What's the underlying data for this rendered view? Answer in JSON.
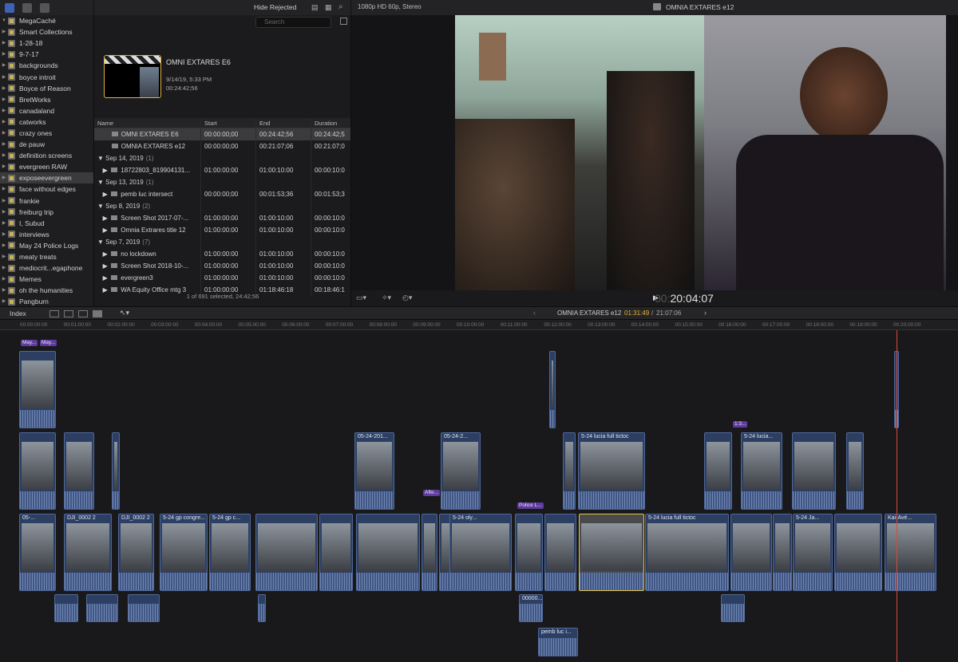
{
  "browser_toolbar": {
    "filter_label": "Hide Rejected"
  },
  "viewer_toolbar": {
    "format": "1080p HD 60p, Stereo",
    "project_title": "OMNIA EXTARES e12"
  },
  "library": {
    "name": "MegaCaché",
    "items": [
      "Smart Collections",
      "1-28-18",
      "9-7-17",
      "backgrounds",
      "boyce introit",
      "Boyce of Reason",
      "BretWorks",
      "canadaland",
      "catworks",
      "crazy ones",
      "de pauw",
      "definition screens",
      "evergreen RAW",
      "exposeevergreen",
      "face without edges",
      "frankie",
      "freiburg trip",
      "I, Subud",
      "interviews",
      "May 24 Police Logs",
      "meaty treats",
      "mediocrit...egaphone",
      "Memes",
      "oh the humanities",
      "Pangburn"
    ]
  },
  "browser": {
    "search_placeholder": "Search",
    "clip_title": "OMNI EXTARES E6",
    "clip_date": "9/14/19, 5:33 PM",
    "clip_duration": "00:24:42;56",
    "columns": [
      "Name",
      "Start",
      "End",
      "Duration"
    ],
    "rows": [
      {
        "type": "clip",
        "name": "OMNI EXTARES E6",
        "start": "00:00:00;00",
        "end": "00:24:42;56",
        "duration": "00:24:42;5"
      },
      {
        "type": "clip",
        "name": "OMNIA EXTARES e12",
        "start": "00:00:00;00",
        "end": "00:21:07;06",
        "duration": "00:21:07;0"
      },
      {
        "type": "group",
        "name": "Sep 14, 2019",
        "count": "(1)"
      },
      {
        "type": "clip",
        "name": "18722803_819904131...",
        "start": "01:00:00:00",
        "end": "01:00:10:00",
        "duration": "00:00:10:0"
      },
      {
        "type": "group",
        "name": "Sep 13, 2019",
        "count": "(1)"
      },
      {
        "type": "clip",
        "name": "pemb luc intersect",
        "start": "00:00:00;00",
        "end": "00:01:53;36",
        "duration": "00:01:53;3"
      },
      {
        "type": "group",
        "name": "Sep 8, 2019",
        "count": "(2)"
      },
      {
        "type": "clip",
        "name": "Screen Shot 2017-07-...",
        "start": "01:00:00:00",
        "end": "01:00:10:00",
        "duration": "00:00:10:0"
      },
      {
        "type": "clip",
        "name": "Omnia Extrares title 12",
        "start": "01:00:00:00",
        "end": "01:00:10:00",
        "duration": "00:00:10:0"
      },
      {
        "type": "group",
        "name": "Sep 7, 2019",
        "count": "(7)"
      },
      {
        "type": "clip",
        "name": "no lockdown",
        "start": "01:00:00:00",
        "end": "01:00:10:00",
        "duration": "00:00:10:0"
      },
      {
        "type": "clip",
        "name": "Screen Shot 2018-10-...",
        "start": "01:00:00:00",
        "end": "01:00:10:00",
        "duration": "00:00:10:0"
      },
      {
        "type": "clip",
        "name": "evergreen3",
        "start": "01:00:00:00",
        "end": "01:00:10:00",
        "duration": "00:00:10:0"
      },
      {
        "type": "clip",
        "name": "WA Equity Office mtg 3",
        "start": "01:00:00:00",
        "end": "01:18:46:18",
        "duration": "00:18:46:1"
      }
    ],
    "status": "1 of 691 selected, 24:42;56"
  },
  "viewer": {
    "timecode_dim": "00:",
    "timecode": "20:04:07"
  },
  "timeline": {
    "index_label": "Index",
    "project": "OMNIA EXTARES e12",
    "position": "01:31:49",
    "total": "21:07:06",
    "ruler": [
      "00:00:00:00",
      "00:01:00:00",
      "00:02:00:00",
      "00:03:00:00",
      "00:04:00:00",
      "00:05:00:00",
      "00:06:00:00",
      "00:07:00:00",
      "00:08:00:00",
      "00:09:00:00",
      "00:10:00:00",
      "00:11:00:00",
      "00:12:00:00",
      "00:13:00:00",
      "00:14:00:00",
      "00:15:00:00",
      "00:16:00:00",
      "00:17:00:00",
      "00:18:00:00",
      "00:19:00:00",
      "00:20:00:00"
    ],
    "clip_labels": [
      "05-...",
      "DJI_0002 2",
      "DJI_0002 2",
      "5-24 gp congre...",
      "5-24 gp c...",
      "5-24 oly...",
      "5-24 lucia full tictoc",
      "5-24 lucia full tictoc",
      "5-24 Ja...",
      "Kai-Avé...",
      "05-24-201...",
      "05-24-2...",
      "5-24 lucia...",
      "Police L...",
      "pemb luc i...",
      "00000..."
    ],
    "markers": [
      "May...",
      "May...",
      "Afte...",
      "1:3..."
    ]
  }
}
